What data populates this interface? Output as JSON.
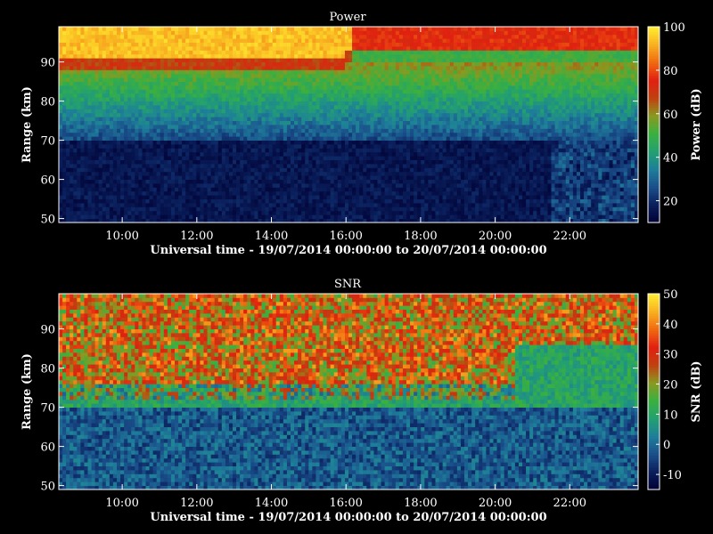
{
  "chart_data": [
    {
      "type": "heatmap",
      "title": "Power",
      "xlabel": "Universal time - 19/07/2014 00:00:00 to 20/07/2014 00:00:00",
      "ylabel": "Range (km)",
      "xlim": [
        "08:18",
        "23:50"
      ],
      "ylim": [
        49,
        99
      ],
      "xticks": [
        "10:00",
        "12:00",
        "14:00",
        "16:00",
        "18:00",
        "20:00",
        "22:00"
      ],
      "yticks": [
        50,
        60,
        70,
        80,
        90
      ],
      "colorbar": {
        "label": "Power (dB)",
        "range": [
          10,
          100
        ],
        "ticks": [
          20,
          40,
          60,
          80,
          100
        ],
        "colormap": [
          "#000033",
          "#0a1f5c",
          "#1a4f8a",
          "#1e7f9a",
          "#23a070",
          "#3ab040",
          "#8a9a20",
          "#c04010",
          "#e02010",
          "#f06a10",
          "#f8b020",
          "#ffee30"
        ]
      },
      "features": {
        "top_band_km": [
          88,
          99
        ],
        "transition_km": [
          70,
          86
        ],
        "low_power_below_km": 70,
        "top_band_power_db": 90,
        "low_power_db": 12
      }
    },
    {
      "type": "heatmap",
      "title": "SNR",
      "xlabel": "Universal time - 19/07/2014 00:00:00 to 20/07/2014 00:00:00",
      "ylabel": "Range (km)",
      "xlim": [
        "08:18",
        "23:50"
      ],
      "ylim": [
        49,
        99
      ],
      "xticks": [
        "10:00",
        "12:00",
        "14:00",
        "16:00",
        "18:00",
        "20:00",
        "22:00"
      ],
      "yticks": [
        50,
        60,
        70,
        80,
        90
      ],
      "colorbar": {
        "label": "SNR (dB)",
        "range": [
          -15,
          50
        ],
        "ticks": [
          -10,
          0,
          10,
          20,
          30,
          40,
          50
        ],
        "colormap": [
          "#000033",
          "#0a1f5c",
          "#1a4f8a",
          "#1e7f9a",
          "#23a070",
          "#3ab040",
          "#8a9a20",
          "#c04010",
          "#e02010",
          "#f06a10",
          "#f8b020",
          "#ffee30"
        ]
      },
      "features": {
        "high_snr_band_km": [
          72,
          99
        ],
        "low_snr_below_km": 70,
        "high_snr_db": 28,
        "low_snr_db": -8
      }
    }
  ]
}
